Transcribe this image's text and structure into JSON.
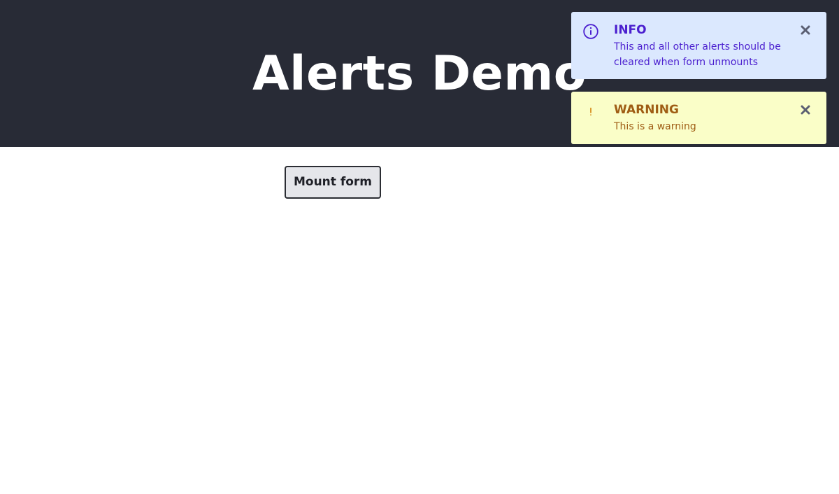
{
  "header": {
    "title": "Alerts Demo"
  },
  "main": {
    "mount_button_label": "Mount form"
  },
  "alerts": [
    {
      "type": "info",
      "title": "INFO",
      "message": "This and all other alerts should be cleared when form unmounts",
      "icon": "info-circle-icon",
      "close_icon": "close-icon",
      "background_color": "#dbe8fe",
      "text_color": "#4b1fcf"
    },
    {
      "type": "warning",
      "title": "WARNING",
      "message": "This is a warning",
      "icon": "exclamation-icon",
      "close_icon": "close-icon",
      "background_color": "#fafec8",
      "text_color": "#9f5d14"
    }
  ],
  "colors": {
    "header_background": "#282b36",
    "button_background": "#e5e6ea",
    "button_border": "#2b2d33"
  }
}
